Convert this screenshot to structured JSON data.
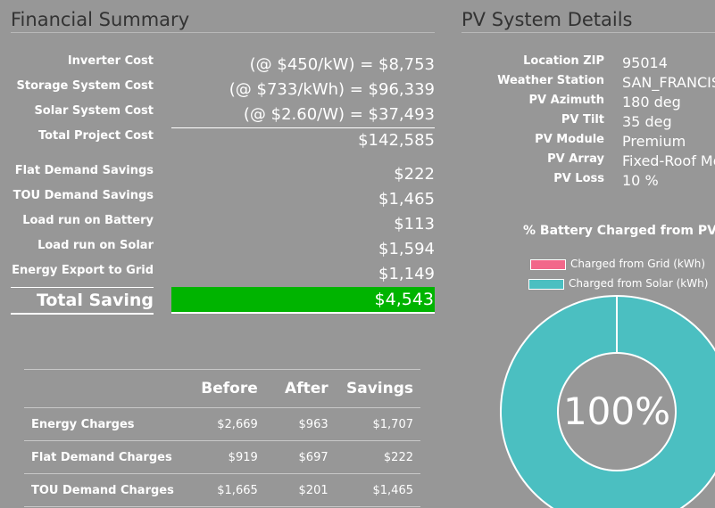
{
  "financial_summary": {
    "title": "Financial Summary",
    "cost_rows": [
      {
        "label": "Inverter Cost",
        "value": "(@ $450/kW) = $8,753"
      },
      {
        "label": "Storage System Cost",
        "value": "(@ $733/kWh) = $96,339"
      },
      {
        "label": "Solar System Cost",
        "value": "(@ $2.60/W) = $37,493"
      },
      {
        "label": "Total Project Cost",
        "value": "$142,585"
      }
    ],
    "saving_rows": [
      {
        "label": "Flat Demand Savings",
        "value": "$222"
      },
      {
        "label": "TOU Demand Savings",
        "value": "$1,465"
      },
      {
        "label": "Load run on Battery",
        "value": "$113"
      },
      {
        "label": "Load run on Solar",
        "value": "$1,594"
      },
      {
        "label": "Energy Export to Grid",
        "value": "$1,149"
      }
    ],
    "total": {
      "label": "Total Saving",
      "value": "$4,543",
      "highlight_color": "#00b400"
    }
  },
  "comparison_table": {
    "headers": [
      "",
      "Before",
      "After",
      "Savings"
    ],
    "rows": [
      {
        "label": "Energy Charges",
        "before": "$2,669",
        "after": "$963",
        "savings": "$1,707"
      },
      {
        "label": "Flat Demand Charges",
        "before": "$919",
        "after": "$697",
        "savings": "$222"
      },
      {
        "label": "TOU Demand Charges",
        "before": "$1,665",
        "after": "$201",
        "savings": "$1,465"
      }
    ]
  },
  "pv_details": {
    "title": "PV System Details",
    "rows": [
      {
        "label": "Location ZIP",
        "value": "95014"
      },
      {
        "label": "Weather Station",
        "value": "SAN_FRANCISCO"
      },
      {
        "label": "PV Azimuth",
        "value": "180 deg"
      },
      {
        "label": "PV Tilt",
        "value": "35 deg"
      },
      {
        "label": "PV Module",
        "value": "Premium"
      },
      {
        "label": "PV Array",
        "value": "Fixed-Roof Mount"
      },
      {
        "label": "PV Loss",
        "value": "10 %"
      }
    ]
  },
  "battery_chart": {
    "title": "% Battery Charged from PV",
    "center_label": "100%",
    "legend": [
      {
        "name": "Charged from Grid (kWh)",
        "color": "#f2678a"
      },
      {
        "name": "Charged from Solar (kWh)",
        "color": "#4bbfc1"
      }
    ]
  },
  "chart_data": {
    "type": "pie",
    "title": "% Battery Charged from PV",
    "categories": [
      "Charged from Grid (kWh)",
      "Charged from Solar (kWh)"
    ],
    "values": [
      0,
      100
    ],
    "legend_position": "top"
  }
}
